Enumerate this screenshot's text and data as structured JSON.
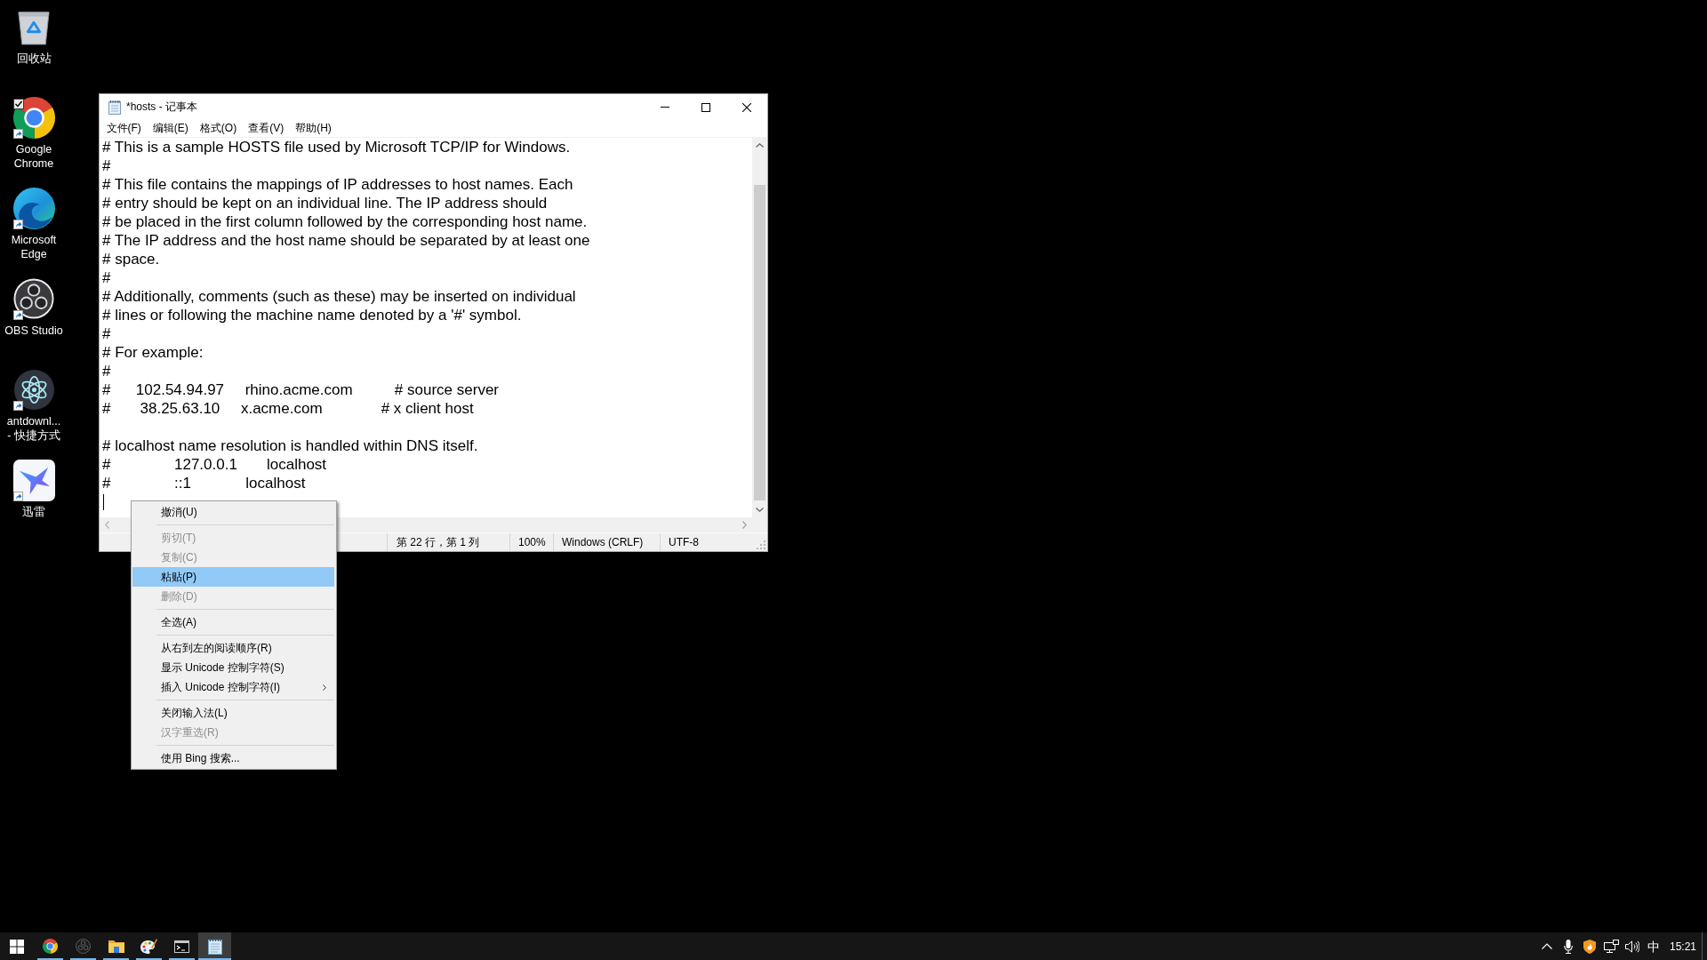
{
  "desktop": {
    "icons": [
      {
        "kind": "recycle",
        "label_lines": [
          "回收站"
        ],
        "shortcut": false,
        "checked": false
      },
      {
        "kind": "chrome",
        "label_lines": [
          "Google",
          "Chrome"
        ],
        "shortcut": true,
        "checked": true
      },
      {
        "kind": "edge",
        "label_lines": [
          "Microsoft",
          "Edge"
        ],
        "shortcut": true,
        "checked": false
      },
      {
        "kind": "obs",
        "label_lines": [
          "OBS Studio"
        ],
        "shortcut": true,
        "checked": false
      },
      {
        "kind": "atom",
        "label_lines": [
          "antdownl...",
          "- 快捷方式"
        ],
        "shortcut": true,
        "checked": false
      },
      {
        "kind": "bird",
        "label_lines": [
          "迅雷"
        ],
        "shortcut": true,
        "checked": false
      }
    ]
  },
  "window": {
    "title": "*hosts - 记事本",
    "menu_bar": [
      "文件(F)",
      "编辑(E)",
      "格式(O)",
      "查看(V)",
      "帮助(H)"
    ],
    "editor": {
      "lines": [
        {
          "kind": "text",
          "text": "# This is a sample HOSTS file used by Microsoft TCP/IP for Windows."
        },
        {
          "kind": "text",
          "text": "#"
        },
        {
          "kind": "text",
          "text": "# This file contains the mappings of IP addresses to host names. Each"
        },
        {
          "kind": "text",
          "text": "# entry should be kept on an individual line. The IP address should"
        },
        {
          "kind": "text",
          "text": "# be placed in the first column followed by the corresponding host name."
        },
        {
          "kind": "text",
          "text": "# The IP address and the host name should be separated by at least one"
        },
        {
          "kind": "text",
          "text": "# space."
        },
        {
          "kind": "text",
          "text": "#"
        },
        {
          "kind": "text",
          "text": "# Additionally, comments (such as these) may be inserted on individual"
        },
        {
          "kind": "text",
          "text": "# lines or following the machine name denoted by a '#' symbol."
        },
        {
          "kind": "text",
          "text": "#"
        },
        {
          "kind": "text",
          "text": "# For example:"
        },
        {
          "kind": "text",
          "text": "#"
        },
        {
          "kind": "text",
          "text": "#      102.54.94.97     rhino.acme.com          # source server"
        },
        {
          "kind": "text",
          "text": "#       38.25.63.10     x.acme.com              # x client host"
        },
        {
          "kind": "blank"
        },
        {
          "kind": "text",
          "text": "# localhost name resolution is handled within DNS itself."
        },
        {
          "kind": "text",
          "text": "#\t127.0.0.1       localhost"
        },
        {
          "kind": "text",
          "text": "#\t::1             localhost"
        },
        {
          "kind": "caret"
        }
      ]
    },
    "status_bar": {
      "cursor_position": "第 22 行，第 1 列",
      "zoom": "100%",
      "line_ending": "Windows (CRLF)",
      "encoding": "UTF-8"
    }
  },
  "context_menu": {
    "groups": [
      {
        "items": [
          {
            "label": "撤消(U)",
            "disabled": false,
            "selected": false,
            "submenu": false
          }
        ]
      },
      {
        "items": [
          {
            "label": "剪切(T)",
            "disabled": true,
            "selected": false,
            "submenu": false
          },
          {
            "label": "复制(C)",
            "disabled": true,
            "selected": false,
            "submenu": false
          },
          {
            "label": "粘贴(P)",
            "disabled": false,
            "selected": true,
            "submenu": false
          },
          {
            "label": "删除(D)",
            "disabled": true,
            "selected": false,
            "submenu": false
          }
        ]
      },
      {
        "items": [
          {
            "label": "全选(A)",
            "disabled": false,
            "selected": false,
            "submenu": false
          }
        ]
      },
      {
        "items": [
          {
            "label": "从右到左的阅读顺序(R)",
            "disabled": false,
            "selected": false,
            "submenu": false
          },
          {
            "label": "显示 Unicode 控制字符(S)",
            "disabled": false,
            "selected": false,
            "submenu": false
          },
          {
            "label": "插入 Unicode 控制字符(I)",
            "disabled": false,
            "selected": false,
            "submenu": true
          }
        ]
      },
      {
        "items": [
          {
            "label": "关闭输入法(L)",
            "disabled": false,
            "selected": false,
            "submenu": false
          },
          {
            "label": "汉字重选(R)",
            "disabled": true,
            "selected": false,
            "submenu": false
          }
        ]
      },
      {
        "items": [
          {
            "label": "使用 Bing 搜索...",
            "disabled": false,
            "selected": false,
            "submenu": false
          }
        ]
      }
    ]
  },
  "taskbar": {
    "apps": [
      {
        "kind": "chrome",
        "running": true,
        "selected": false
      },
      {
        "kind": "obs",
        "running": true,
        "selected": false
      },
      {
        "kind": "folder",
        "running": true,
        "selected": false
      },
      {
        "kind": "palette",
        "running": true,
        "selected": false
      },
      {
        "kind": "terminal",
        "running": true,
        "selected": false
      },
      {
        "kind": "notepad",
        "running": true,
        "selected": true
      }
    ],
    "tray": {
      "input_method": "中",
      "clock": "15:21"
    }
  }
}
